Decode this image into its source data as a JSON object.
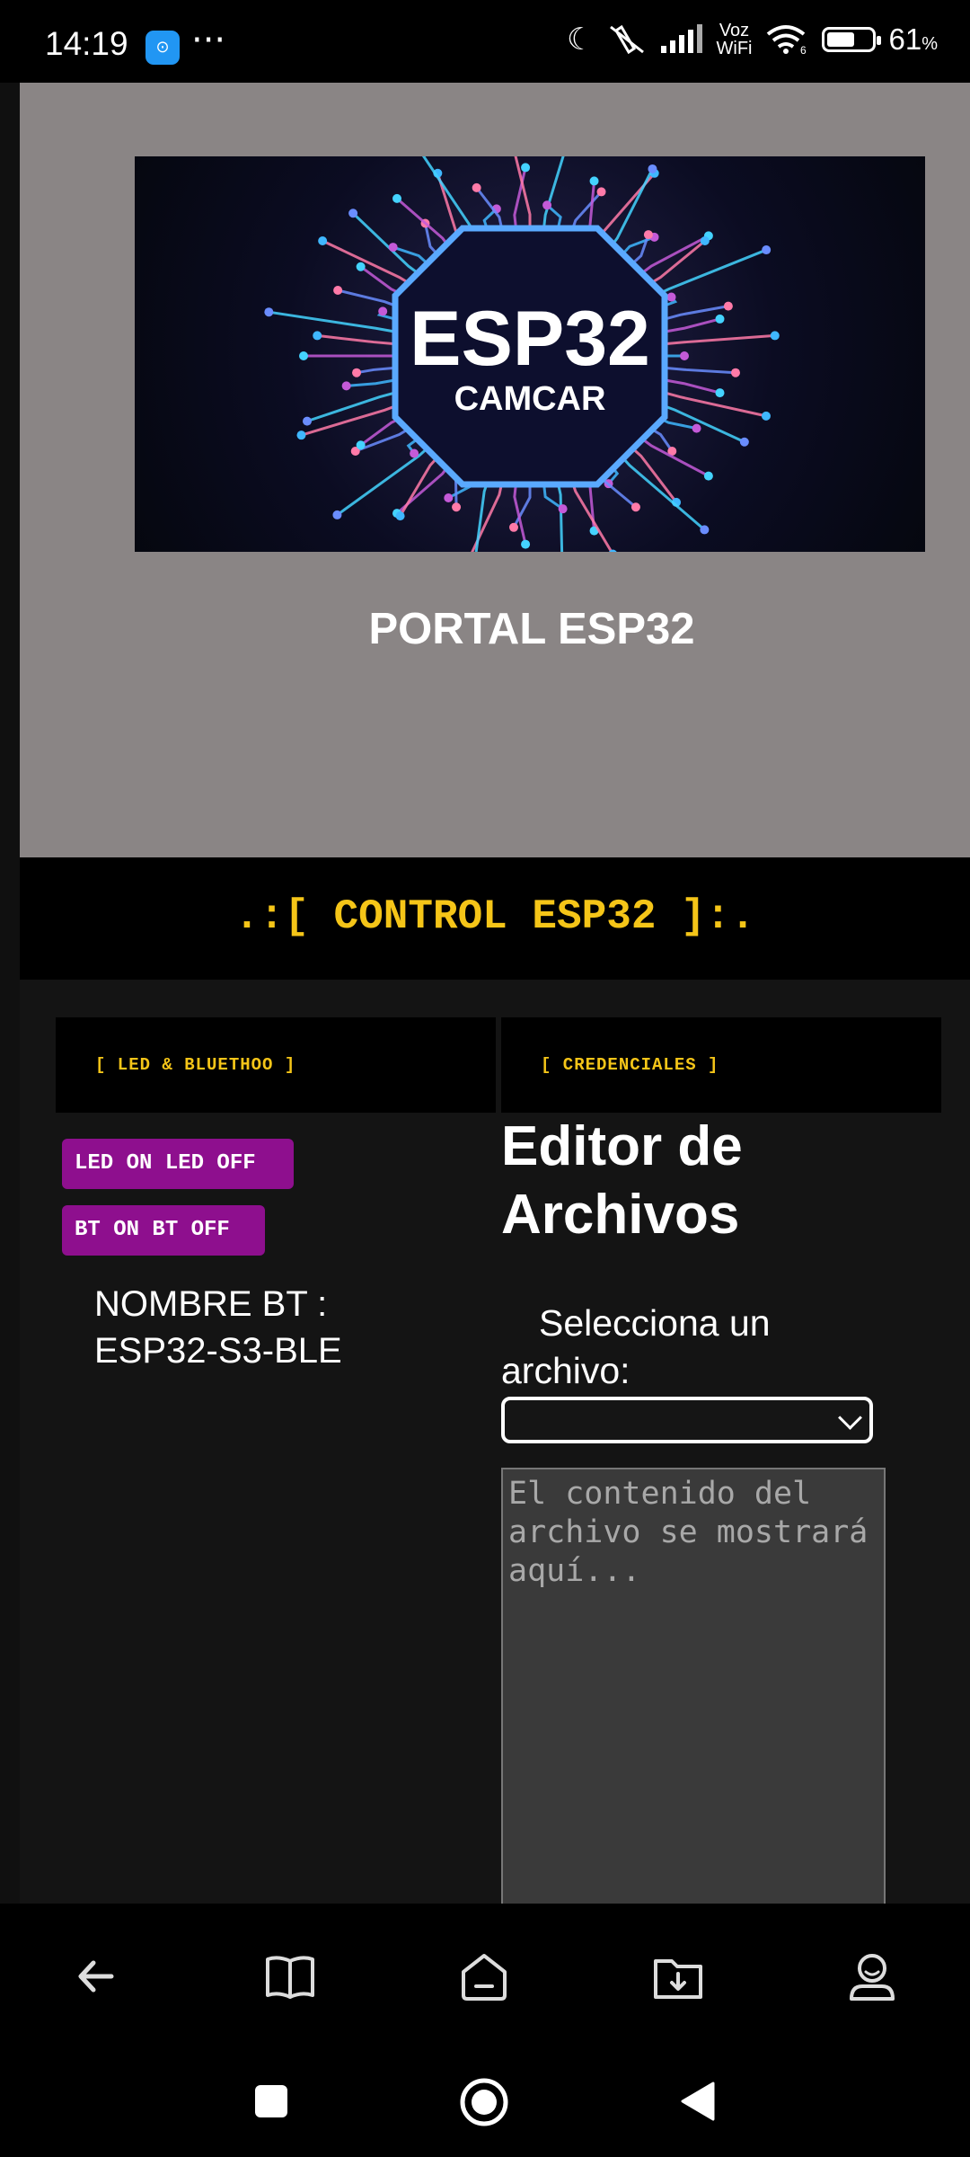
{
  "status_bar": {
    "time": "14:19",
    "app_icon": "app-icon",
    "more": "···",
    "voz": "Voz",
    "wifi_label": "WiFi",
    "wifi_sub": "6",
    "battery_level": 61,
    "battery_pct": "61",
    "battery_unit": "%"
  },
  "header": {
    "banner_title": "ESP32",
    "banner_subtitle": "CAMCAR",
    "portal_title": "PORTAL ESP32"
  },
  "control": {
    "title": ".:[ CONTROL ESP32 ]:."
  },
  "tabs": {
    "left": "[ LED & BLUETHOO ]",
    "right": "[ CREDENCIALES ]"
  },
  "left_panel": {
    "led_label": "LED ON LED OFF",
    "bt_label": "BT ON BT OFF",
    "bt_name_label": "NOMBRE BT :",
    "bt_name_value": "ESP32-S3-BLE"
  },
  "editor": {
    "title": "Editor de Archivos",
    "select_label": "Selecciona un archivo:",
    "select_value": "",
    "content_placeholder": "El contenido del archivo se mostrará aquí..."
  },
  "colors": {
    "accent_yellow": "#f5c518",
    "button_purple": "#8e0f8e",
    "header_gray": "#8a8585"
  },
  "browser_nav": [
    "back-icon",
    "book-icon",
    "home-icon",
    "download-icon",
    "profile-icon"
  ],
  "system_nav": [
    "recents-icon",
    "home-circle-icon",
    "back-triangle-icon"
  ]
}
